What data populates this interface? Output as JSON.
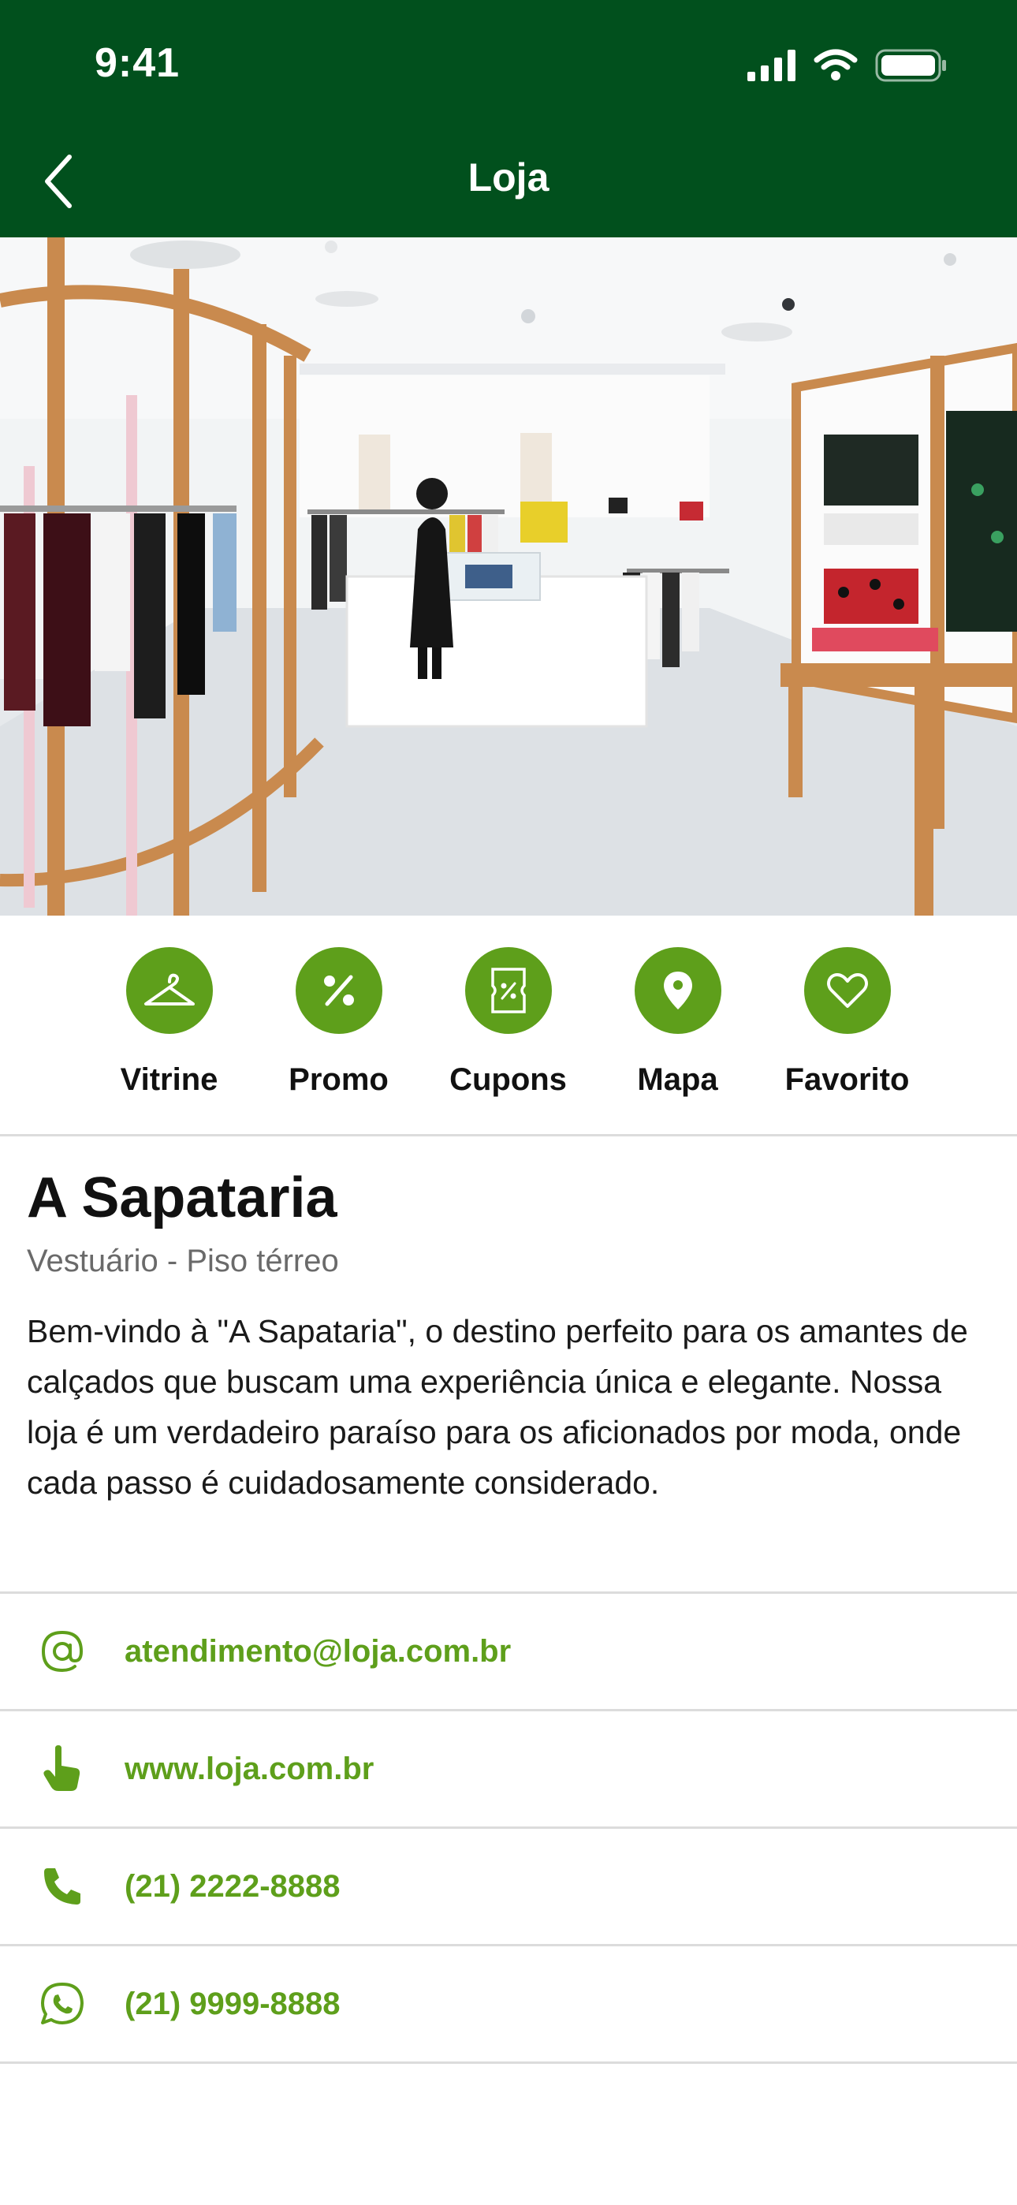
{
  "status": {
    "time": "9:41"
  },
  "nav": {
    "title": "Loja"
  },
  "hero": {
    "alt": "Interior de loja de roupas"
  },
  "actions": [
    {
      "label": "Vitrine",
      "icon": "hanger-icon"
    },
    {
      "label": "Promo",
      "icon": "percent-icon"
    },
    {
      "label": "Cupons",
      "icon": "coupon-icon"
    },
    {
      "label": "Mapa",
      "icon": "map-pin-icon"
    },
    {
      "label": "Favorito",
      "icon": "heart-icon"
    }
  ],
  "store": {
    "name": "A Sapataria",
    "subtitle": "Vestuário - Piso térreo",
    "description": "Bem-vindo à \"A Sapataria\", o destino perfeito para os amantes de calçados que buscam uma experiência única e elegante. Nossa loja é um verdadeiro paraíso para os aficionados por moda, onde cada passo é cuidadosamente considerado."
  },
  "contacts": [
    {
      "type": "email",
      "icon": "at-icon",
      "text": "atendimento@loja.com.br"
    },
    {
      "type": "website",
      "icon": "pointer-hand-icon",
      "text": "www.loja.com.br"
    },
    {
      "type": "phone",
      "icon": "phone-icon",
      "text": "(21) 2222-8888"
    },
    {
      "type": "whatsapp",
      "icon": "whatsapp-icon",
      "text": "(21) 9999-8888"
    }
  ],
  "colors": {
    "header": "#01501d",
    "accent": "#5e9f1b",
    "divider": "#dcdcdc"
  }
}
